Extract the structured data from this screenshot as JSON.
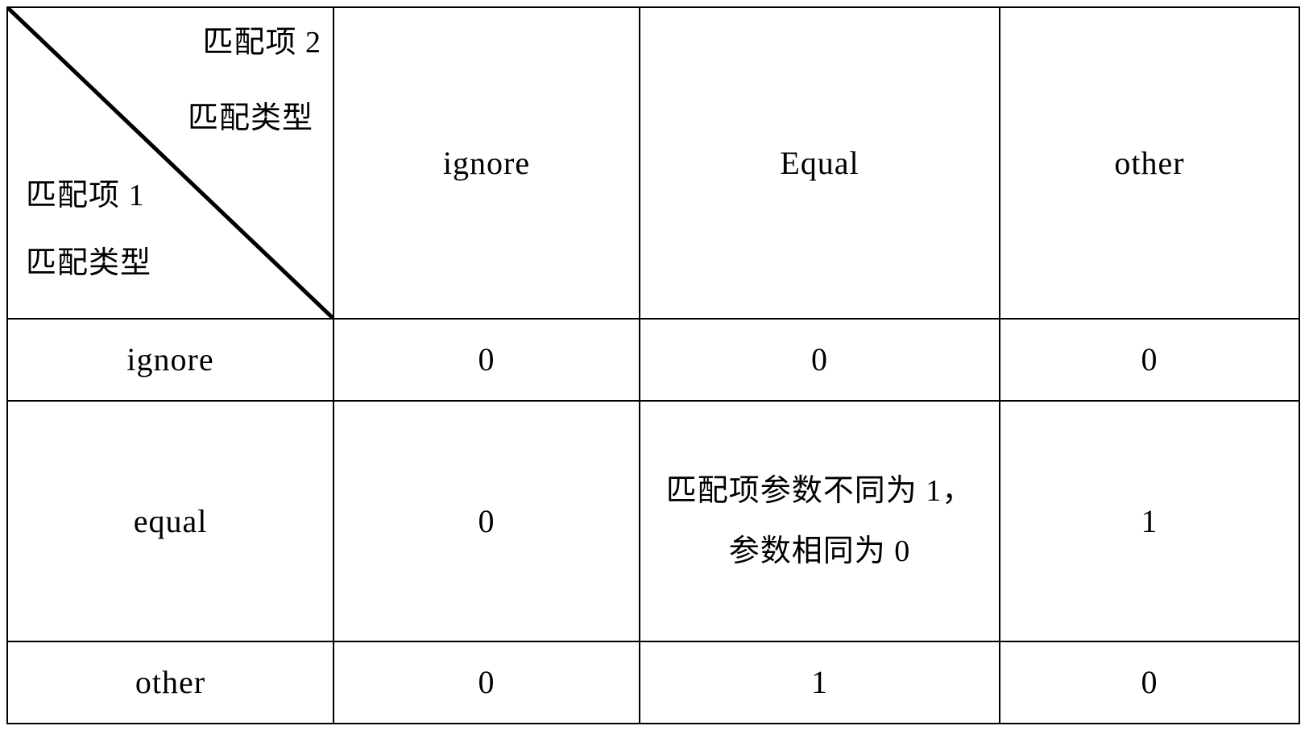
{
  "table": {
    "corner": {
      "column_axis_line1": "匹配项 2",
      "column_axis_line2": "匹配类型",
      "row_axis_line1": "匹配项 1",
      "row_axis_line2": "匹配类型"
    },
    "column_headers": [
      "ignore",
      "Equal",
      "other"
    ],
    "row_headers": [
      "ignore",
      "equal",
      "other"
    ],
    "rows": [
      {
        "label": "ignore",
        "cells": [
          "0",
          "0",
          "0"
        ]
      },
      {
        "label": "equal",
        "cells": [
          "0",
          "匹配项参数不同为 1，参数相同为 0",
          "1"
        ]
      },
      {
        "label": "other",
        "cells": [
          "0",
          "1",
          "0"
        ]
      }
    ]
  },
  "style": {
    "border_color": "#000000",
    "text_color": "#000000",
    "background": "#ffffff"
  }
}
